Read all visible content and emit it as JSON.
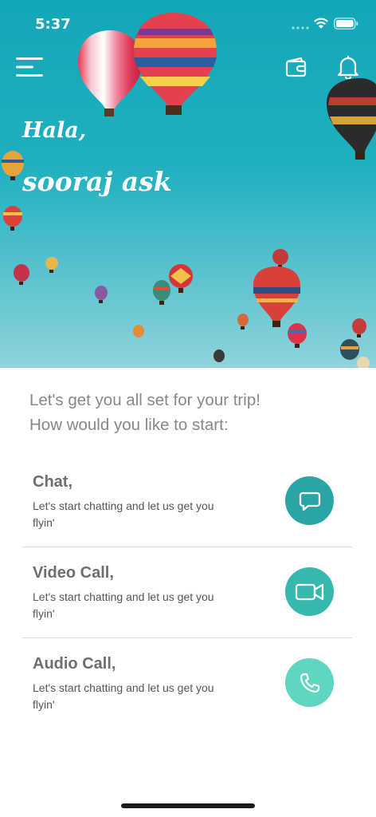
{
  "status_bar": {
    "time": "5:37"
  },
  "header": {
    "greeting": "Hala,",
    "user_name": "sooraj ask"
  },
  "intro": {
    "line1": "Let's get you all set for your trip!",
    "line2": "How would you like to start:"
  },
  "options": [
    {
      "title": "Chat,",
      "description": "Let's start chatting and let us get you flyin'",
      "icon": "chat-bubble-icon",
      "color": "#2aa4a4"
    },
    {
      "title": "Video Call,",
      "description": "Let's start chatting and let us get you flyin'",
      "icon": "video-camera-icon",
      "color": "#36b8ac"
    },
    {
      "title": "Audio Call,",
      "description": "Let's start chatting and let us get you flyin'",
      "icon": "phone-icon",
      "color": "#5fd6c0"
    }
  ],
  "colors": {
    "sky_top": "#12a7b7",
    "sky_bottom": "#8fd3db",
    "text_muted": "#888888"
  }
}
